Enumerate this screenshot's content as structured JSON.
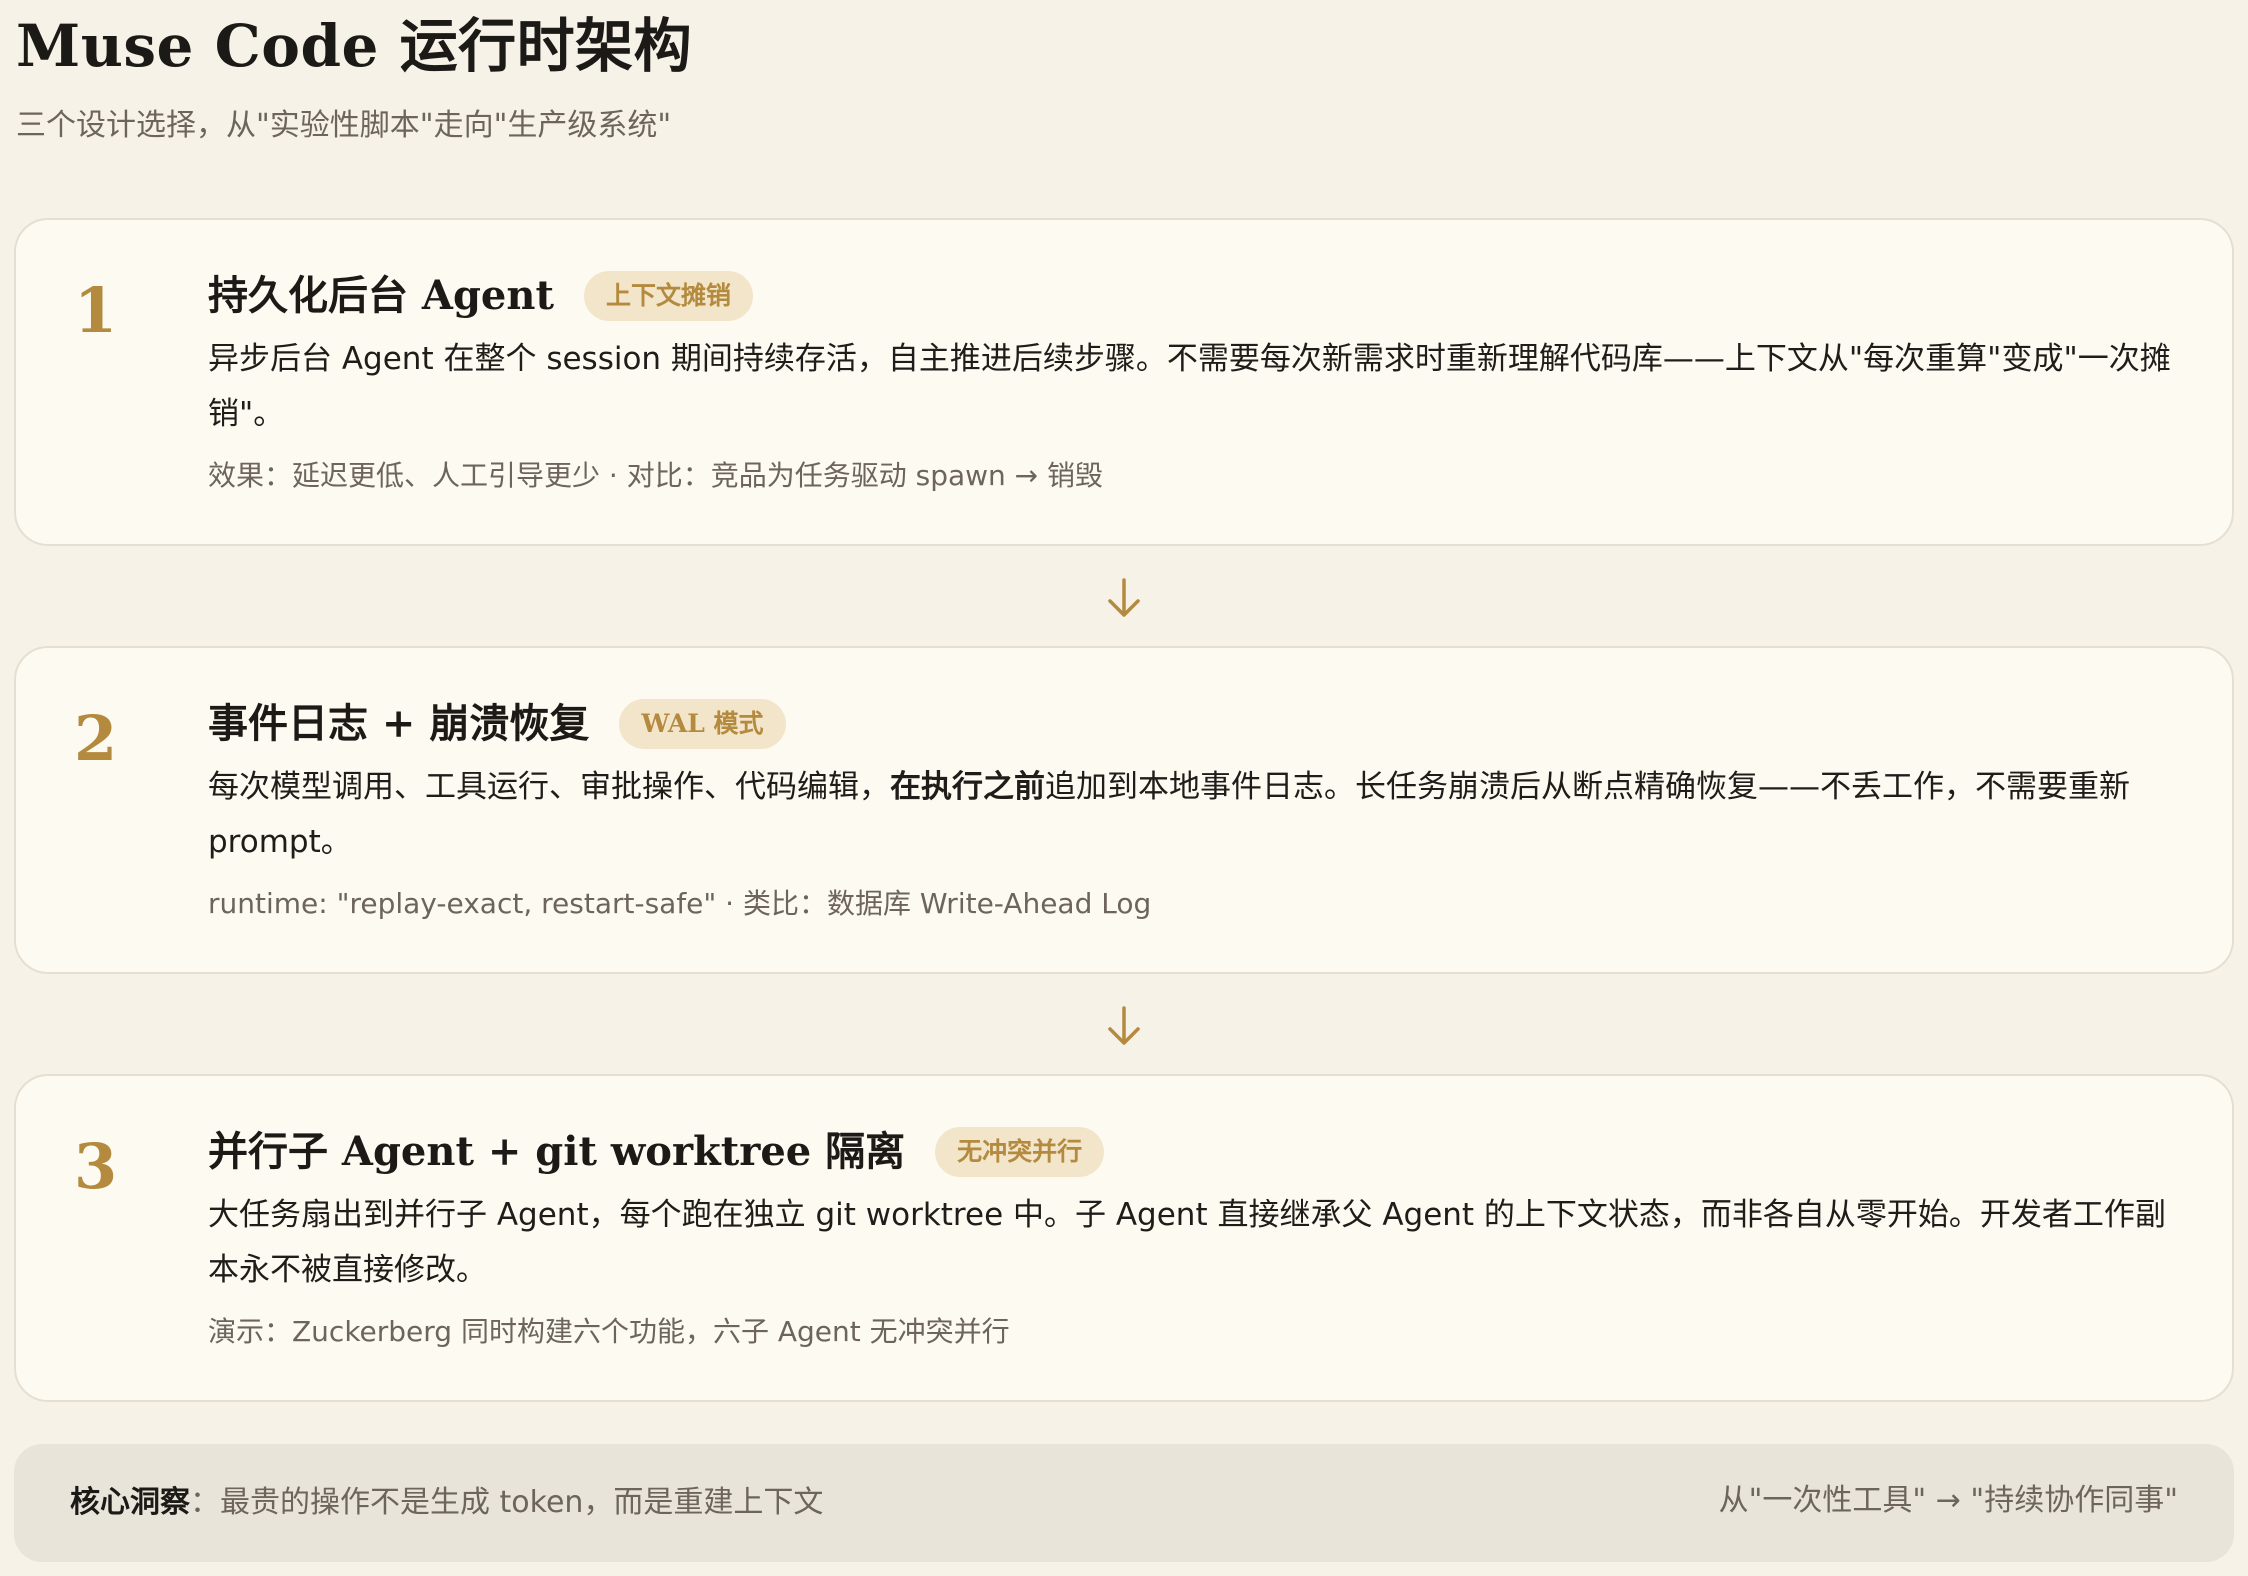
{
  "header": {
    "title": "Muse Code 运行时架构",
    "subtitle": "三个设计选择，从\"实验性脚本\"走向\"生产级系统\""
  },
  "cards": [
    {
      "number": "1",
      "title": "持久化后台 Agent",
      "badge": "上下文摊销",
      "desc_a": "异步后台 Agent 在整个 session 期间持续存活，自主推进后续步骤。不需要每次新需求时重新理解代码库——上下文从\"每次重算\"变成\"一次摊销\"。",
      "desc_bold": "",
      "desc_b": "",
      "meta": "效果：延迟更低、人工引导更少 · 对比：竞品为任务驱动 spawn → 销毁"
    },
    {
      "number": "2",
      "title": "事件日志 + 崩溃恢复",
      "badge": "WAL 模式",
      "desc_a": "每次模型调用、工具运行、审批操作、代码编辑，",
      "desc_bold": "在执行之前",
      "desc_b": "追加到本地事件日志。长任务崩溃后从断点精确恢复——不丢工作，不需要重新 prompt。",
      "meta": "runtime: \"replay-exact, restart-safe\" · 类比：数据库 Write-Ahead Log"
    },
    {
      "number": "3",
      "title": "并行子 Agent + git worktree 隔离",
      "badge": "无冲突并行",
      "desc_a": "大任务扇出到并行子 Agent，每个跑在独立 git worktree 中。子 Agent 直接继承父 Agent 的上下文状态，而非各自从零开始。开发者工作副本永不被直接修改。",
      "desc_bold": "",
      "desc_b": "",
      "meta": "演示：Zuckerberg 同时构建六个功能，六子 Agent 无冲突并行"
    }
  ],
  "footer": {
    "insight_label": "核心洞察",
    "insight_text": "：最贵的操作不是生成 token，而是重建上下文",
    "right_text": "从\"一次性工具\" → \"持续协作同事\""
  },
  "colors": {
    "background": "#f6f2e8",
    "card": "#fdfaf2",
    "accent": "#b38a3e",
    "badge_bg": "#f2e5ca",
    "footer_bg": "#e9e4da"
  },
  "icons": {
    "connector": "arrow-down-icon"
  }
}
